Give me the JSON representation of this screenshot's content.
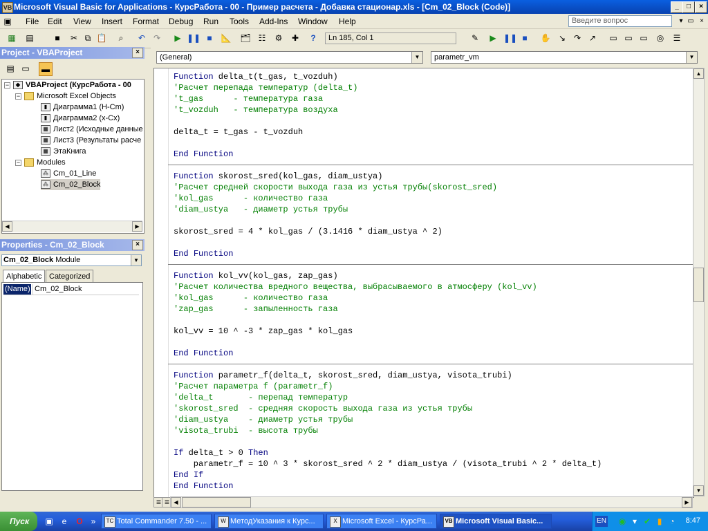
{
  "window": {
    "title": "Microsoft Visual Basic for Applications - КурсРабота - 00 - Пример расчета - Добавка стационар.xls - [Cm_02_Block (Code)]"
  },
  "menu": {
    "items": [
      "File",
      "Edit",
      "View",
      "Insert",
      "Format",
      "Debug",
      "Run",
      "Tools",
      "Add-Ins",
      "Window",
      "Help"
    ],
    "help_placeholder": "Введите вопрос"
  },
  "toolbar": {
    "position": "Ln 185, Col 1"
  },
  "project": {
    "title": "Project - VBAProject",
    "nodes": [
      "VBAProject (КурсРабота - 00",
      "Microsoft Excel Objects",
      "Диаграмма1 (H-Cm)",
      "Диаграмма2 (x-Cx)",
      "Лист2 (Исходные данные",
      "Лист3 (Результаты расче",
      "ЭтаКнига",
      "Modules",
      "Cm_01_Line",
      "Cm_02_Block"
    ]
  },
  "properties": {
    "title": "Properties - Cm_02_Block",
    "object_name": "Cm_02_Block",
    "object_type": "Module",
    "tabs": [
      "Alphabetic",
      "Categorized"
    ],
    "name_key": "(Name)",
    "name_value": "Cm_02_Block"
  },
  "code": {
    "object_combo": "(General)",
    "proc_combo": "parametr_vm",
    "lines": [
      "Function delta_t(t_gas, t_vozduh)",
      "'Расчет перепада температур (delta_t)",
      "'t_gas      - температура газа",
      "'t_vozduh   - температура воздуха",
      "",
      "delta_t = t_gas - t_vozduh",
      "",
      "End Function",
      "",
      "Function skorost_sred(kol_gas, diam_ustya)",
      "'Расчет средней скорости выхода газа из устья трубы(skorost_sred)",
      "'kol_gas      - количество газа",
      "'diam_ustya   - диаметр устья трубы",
      "",
      "skorost_sred = 4 * kol_gas / (3.1416 * diam_ustya ^ 2)",
      "",
      "End Function",
      "",
      "Function kol_vv(kol_gas, zap_gas)",
      "'Расчет количества вредного вещества, выбрасываемого в атмосферу (kol_vv)",
      "'kol_gas      - количество газа",
      "'zap_gas      - запыленность газа",
      "",
      "kol_vv = 10 ^ -3 * zap_gas * kol_gas",
      "",
      "End Function",
      "",
      "Function parametr_f(delta_t, skorost_sred, diam_ustya, visota_trubi)",
      "'Расчет параметра f (parametr_f)",
      "'delta_t       - перепад температур",
      "'skorost_sred  - средняя скорость выхода газа из устья трубы",
      "'diam_ustya    - диаметр устья трубы",
      "'visota_trubi  - высота трубы",
      "",
      "If delta_t > 0 Then",
      "    parametr_f = 10 ^ 3 * skorost_sred ^ 2 * diam_ustya / (visota_trubi ^ 2 * delta_t)",
      "End If",
      "End Function"
    ]
  },
  "taskbar": {
    "start": "Пуск",
    "tasks": [
      "Total Commander 7.50 - ...",
      "МетодУказания к Курс...",
      "Microsoft Excel - КурсРа...",
      "Microsoft Visual Basic..."
    ],
    "lang": "EN",
    "clock": "8:47"
  }
}
